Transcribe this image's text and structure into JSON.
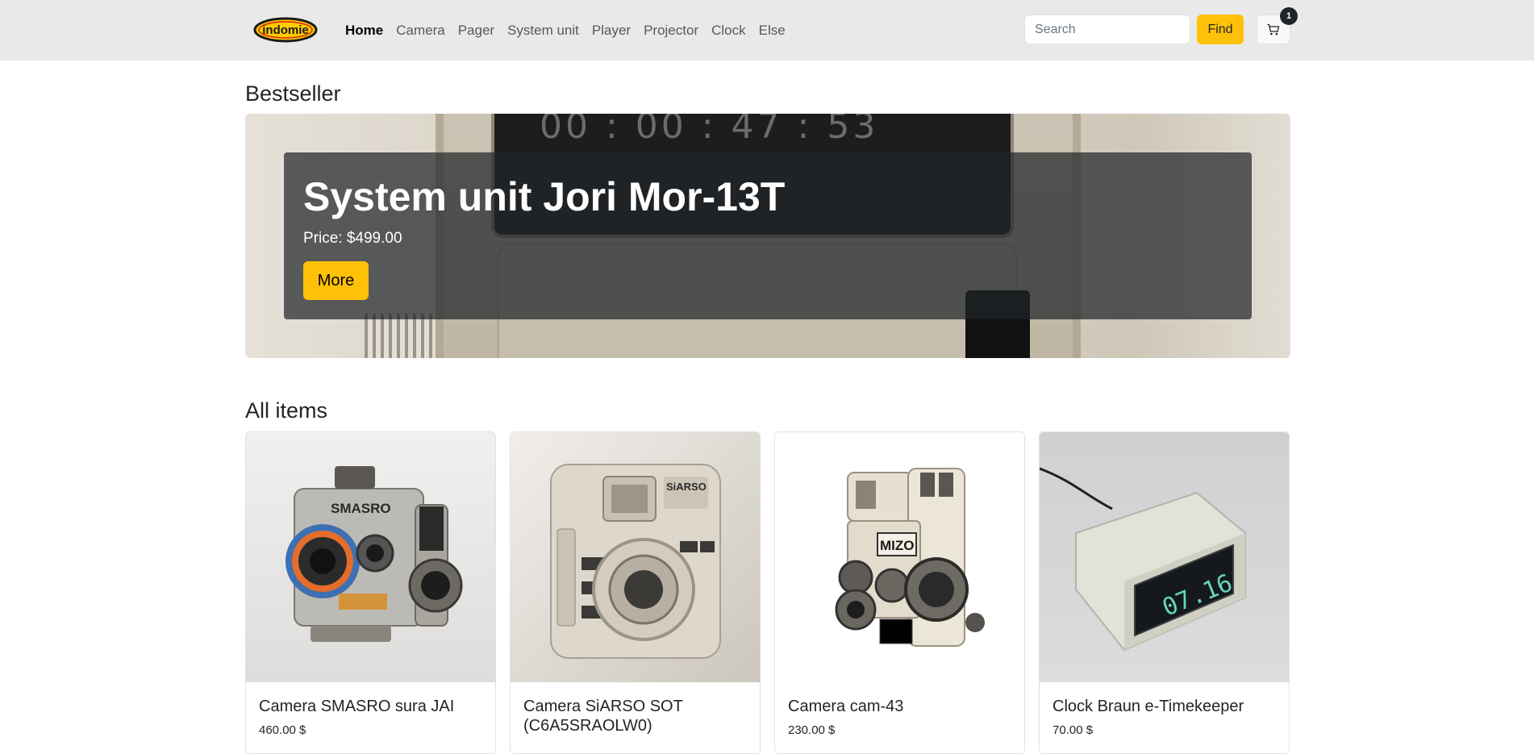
{
  "navbar": {
    "logo_text": "indomie",
    "links": [
      {
        "label": "Home",
        "active": true
      },
      {
        "label": "Camera",
        "active": false
      },
      {
        "label": "Pager",
        "active": false
      },
      {
        "label": "System unit",
        "active": false
      },
      {
        "label": "Player",
        "active": false
      },
      {
        "label": "Projector",
        "active": false
      },
      {
        "label": "Clock",
        "active": false
      },
      {
        "label": "Else",
        "active": false
      }
    ],
    "search": {
      "placeholder": "Search",
      "value": ""
    },
    "find_label": "Find",
    "cart": {
      "icon": "cart-icon",
      "count": "1"
    }
  },
  "bestseller": {
    "heading": "Bestseller",
    "clock_digits": "00 : 00 : 47 : 53",
    "title": "System unit Jori Mor-13T",
    "price_label": "Price:",
    "price_value": "$499.00",
    "more_label": "More"
  },
  "all_items": {
    "heading": "All items",
    "products": [
      {
        "name": "Camera SMASRO sura JAI",
        "price": "460.00 $",
        "image_label": "SMASRO"
      },
      {
        "name": "Camera SiARSO SOT (C6A5SRAOLW0)",
        "price": "",
        "image_label": "SiARSO"
      },
      {
        "name": "Camera cam-43",
        "price": "230.00 $",
        "image_label": "MIZO"
      },
      {
        "name": "Clock Braun e-Timekeeper",
        "price": "70.00 $",
        "image_label": "07.16"
      }
    ]
  },
  "colors": {
    "navbar_bg": "#e9e9e9",
    "accent": "#ffc107",
    "text": "#212529",
    "caption_overlay": "rgba(33,37,41,0.72)"
  }
}
